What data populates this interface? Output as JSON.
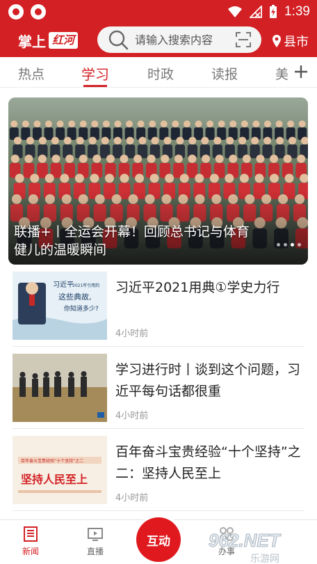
{
  "status_bar": {
    "time": "1:39"
  },
  "header": {
    "logo_text": "掌上",
    "logo_script": "红河",
    "search_placeholder": "请输入搜索内容",
    "location": "县市"
  },
  "tabs": [
    {
      "label": "热点"
    },
    {
      "label": "学习"
    },
    {
      "label": "时政"
    },
    {
      "label": "读报"
    },
    {
      "label": "美"
    }
  ],
  "banner": {
    "caption": "联播+丨全运会开幕！回顾总书记与体育健儿的温暖瞬间",
    "dots": 4
  },
  "news": [
    {
      "title": "习近平2021用典①学史力行",
      "time": "4小时前",
      "thumb_lines": [
        "习近平",
        "2021年引用的",
        "这些典故,",
        "你知道多少?"
      ]
    },
    {
      "title": "学习进行时丨谈到这个问题，习近平每句话都很重",
      "time": "4小时前"
    },
    {
      "title": "百年奋斗宝贵经验“十个坚持”之二：坚持人民至上",
      "time": "4小时前",
      "thumb_lines": [
        "百年奋斗宝贵经验“十个坚持”之二",
        "坚持人民至上"
      ]
    }
  ],
  "bottom_nav": {
    "items": [
      {
        "label": "新闻"
      },
      {
        "label": "直播"
      },
      {
        "label": "办事"
      }
    ],
    "center_label": "互动"
  },
  "watermark": {
    "text": "962.NET",
    "sub": "乐游网"
  },
  "colors": {
    "brand_red": "#d32024"
  }
}
